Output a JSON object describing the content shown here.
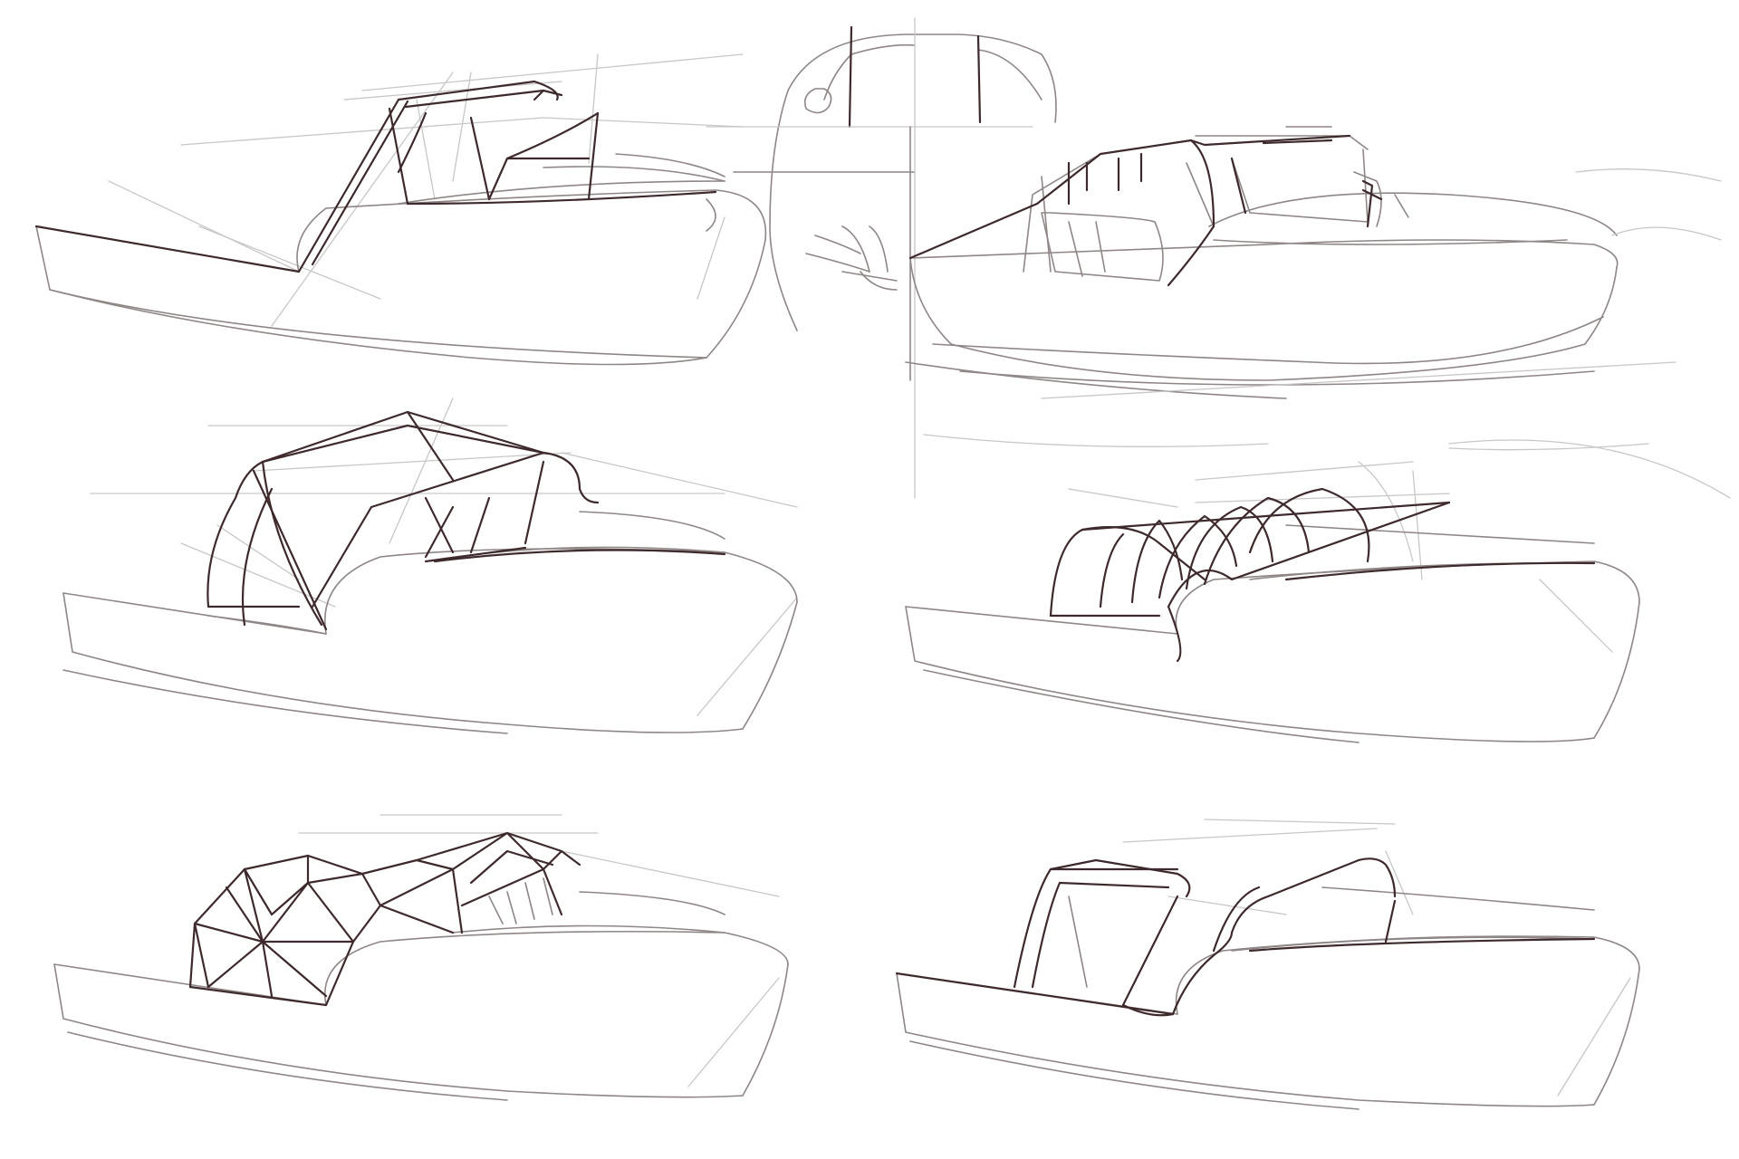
{
  "colors": {
    "paper": "#ffffff",
    "construction_line": "#c9c6c6",
    "sketch_line": "#8f8686",
    "ink_line": "#3e2a2c"
  },
  "sketches": [
    {
      "name": "boat-sketch-rigid-canopy"
    },
    {
      "name": "boat-sketch-front-view-and-cabin"
    },
    {
      "name": "boat-sketch-folding-bimini"
    },
    {
      "name": "boat-sketch-hoop-cover"
    },
    {
      "name": "boat-sketch-geodesic-canopy"
    },
    {
      "name": "boat-sketch-loop-frame"
    }
  ]
}
